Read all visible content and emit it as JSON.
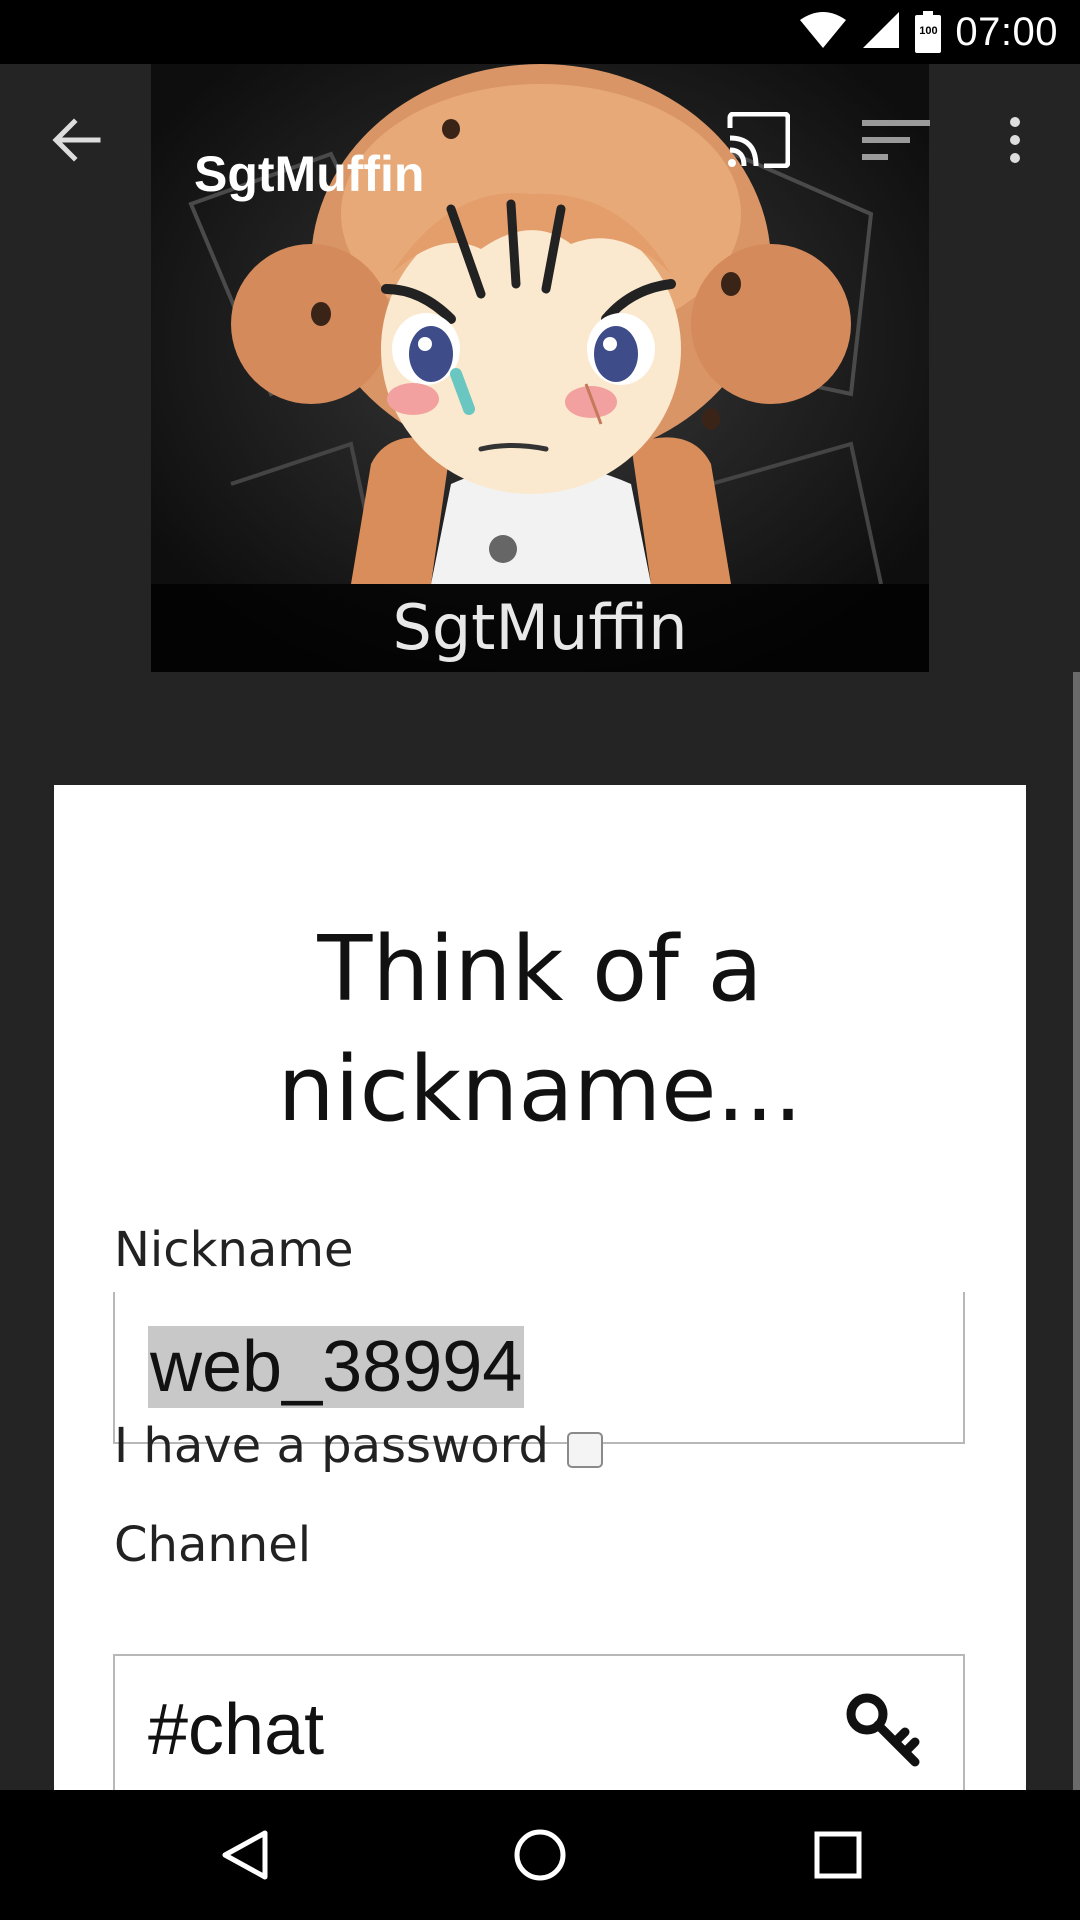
{
  "status_bar": {
    "time": "07:00",
    "battery_level": "100",
    "icons": [
      "wifi-icon",
      "cell-signal-icon",
      "battery-icon"
    ]
  },
  "toolbar": {
    "title": "SgtMuffin",
    "icons": [
      "back-arrow-icon",
      "cast-icon",
      "sort-icon",
      "overflow-menu-icon"
    ]
  },
  "banner": {
    "caption": "SgtMuffin"
  },
  "form": {
    "heading_line1": "Think of a",
    "heading_line2": "nickname...",
    "nickname_label": "Nickname",
    "nickname_value": "web_38994",
    "password_label": "I have a password",
    "password_checked": false,
    "channel_label": "Channel",
    "channel_value": "#chat",
    "submit_color": "#0aa5e7"
  },
  "navigation": {
    "icons": [
      "back-triangle-icon",
      "home-circle-icon",
      "recents-square-icon"
    ]
  },
  "colors": {
    "app_background": "#242424",
    "card_background": "#ffffff",
    "accent": "#0aa5e7"
  }
}
